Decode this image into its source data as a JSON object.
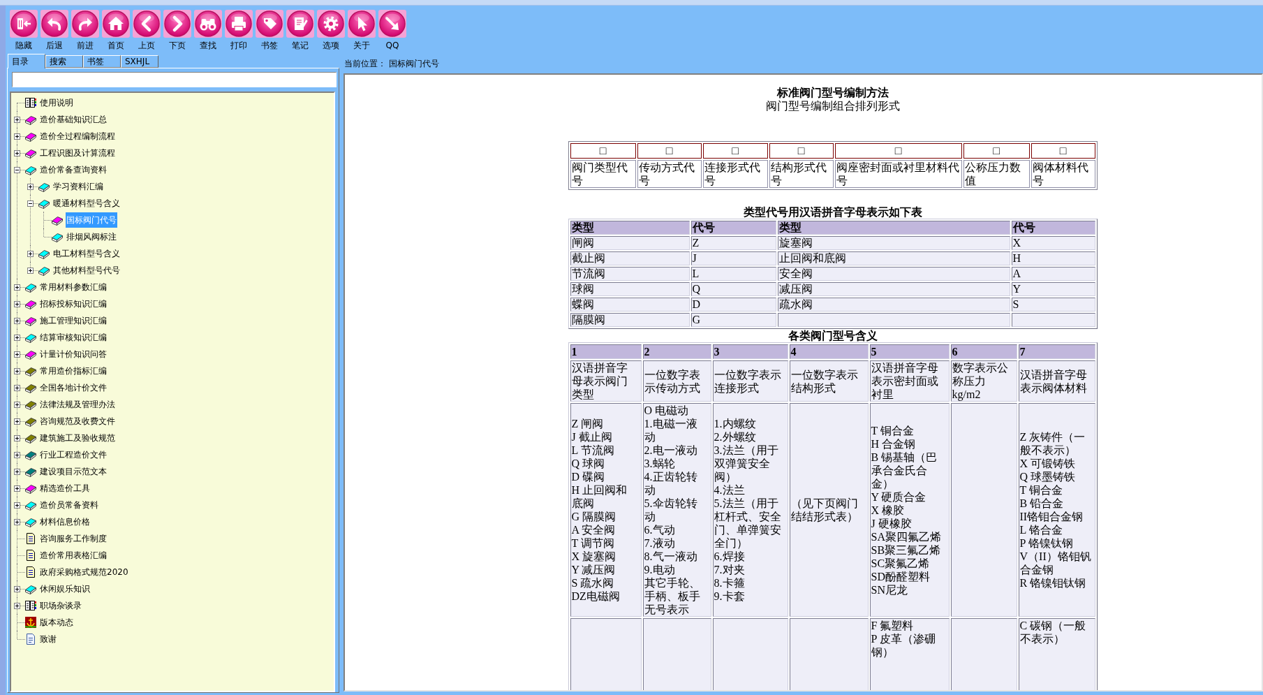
{
  "toolbar": {
    "buttons": [
      {
        "kind": "hide",
        "label": "隐藏"
      },
      {
        "kind": "back",
        "label": "后退"
      },
      {
        "kind": "forward",
        "label": "前进"
      },
      {
        "kind": "home",
        "label": "首页"
      },
      {
        "kind": "prev",
        "label": "上页"
      },
      {
        "kind": "next",
        "label": "下页"
      },
      {
        "kind": "find",
        "label": "查找"
      },
      {
        "kind": "print",
        "label": "打印"
      },
      {
        "kind": "bookmark",
        "label": "书签"
      },
      {
        "kind": "note",
        "label": "笔记"
      },
      {
        "kind": "options",
        "label": "选项"
      },
      {
        "kind": "about",
        "label": "关于"
      },
      {
        "kind": "qq",
        "label": "QQ"
      }
    ]
  },
  "sidebar": {
    "tabs": [
      {
        "label": "目录",
        "selected": true
      },
      {
        "label": "搜索",
        "selected": false
      },
      {
        "label": "书签",
        "selected": false
      },
      {
        "label": "SXHJL",
        "selected": false
      }
    ],
    "tree": {
      "items": [
        {
          "label": "使用说明",
          "kind": "manual",
          "selected": false
        },
        {
          "label": "造价基础知识汇总",
          "kind": "book",
          "color": "#ff00ff",
          "expanded": false,
          "selected": false
        },
        {
          "label": "造价全过程编制流程",
          "kind": "book",
          "color": "#ff00ff",
          "expanded": false,
          "selected": false
        },
        {
          "label": "工程识图及计算流程",
          "kind": "book",
          "color": "#ff00ff",
          "expanded": false,
          "selected": false
        },
        {
          "label": "造价常备查询资料",
          "kind": "book",
          "color": "#00ffff",
          "expanded": true,
          "selected": false,
          "children": [
            {
              "label": "学习资料汇编",
              "kind": "book",
              "color": "#00ffff",
              "expanded": false,
              "selected": false
            },
            {
              "label": "暖通材料型号含义",
              "kind": "book",
              "color": "#00ffff",
              "expanded": true,
              "selected": false,
              "children": [
                {
                  "label": "国标阀门代号",
                  "kind": "book",
                  "color": "#ff00ff",
                  "selected": true
                },
                {
                  "label": "排烟风阀标注",
                  "kind": "book",
                  "color": "#00ffff",
                  "selected": false
                }
              ]
            },
            {
              "label": "电工材料型号含义",
              "kind": "book",
              "color": "#00ffff",
              "expanded": false,
              "selected": false
            },
            {
              "label": "其他材料型号代号",
              "kind": "book",
              "color": "#00ffff",
              "expanded": false,
              "selected": false
            }
          ]
        },
        {
          "label": "常用材料参数汇编",
          "kind": "book",
          "color": "#00ffff",
          "expanded": false,
          "selected": false
        },
        {
          "label": "招标投标知识汇编",
          "kind": "book",
          "color": "#ff00ff",
          "expanded": false,
          "selected": false
        },
        {
          "label": "施工管理知识汇编",
          "kind": "book",
          "color": "#ff00ff",
          "expanded": false,
          "selected": false
        },
        {
          "label": "结算审核知识汇编",
          "kind": "book",
          "color": "#00ffff",
          "expanded": false,
          "selected": false
        },
        {
          "label": "计量计价知识问答",
          "kind": "book",
          "color": "#ff00ff",
          "expanded": false,
          "selected": false
        },
        {
          "label": "常用造价指标汇编",
          "kind": "book",
          "color": "#808000",
          "expanded": false,
          "selected": false
        },
        {
          "label": "全国各地计价文件",
          "kind": "book",
          "color": "#808000",
          "expanded": false,
          "selected": false
        },
        {
          "label": "法律法规及管理办法",
          "kind": "book",
          "color": "#808000",
          "expanded": false,
          "selected": false
        },
        {
          "label": "咨询规范及收费文件",
          "kind": "book",
          "color": "#808000",
          "expanded": false,
          "selected": false
        },
        {
          "label": "建筑施工及验收规范",
          "kind": "book",
          "color": "#808000",
          "expanded": false,
          "selected": false
        },
        {
          "label": "行业工程造价文件",
          "kind": "book",
          "color": "#008080",
          "expanded": false,
          "selected": false
        },
        {
          "label": "建设项目示范文本",
          "kind": "book",
          "color": "#008080",
          "expanded": false,
          "selected": false
        },
        {
          "label": "精选造价工具",
          "kind": "book",
          "color": "#ff00ff",
          "expanded": false,
          "selected": false
        },
        {
          "label": "造价员常备资料",
          "kind": "book",
          "color": "#00ffff",
          "expanded": false,
          "selected": false
        },
        {
          "label": "材料信息价格",
          "kind": "book",
          "color": "#00ffff",
          "expanded": false,
          "selected": false
        },
        {
          "label": "咨询服务工作制度",
          "kind": "note",
          "selected": false
        },
        {
          "label": "造价常用表格汇编",
          "kind": "note",
          "selected": false
        },
        {
          "label": "政府采购格式规范2020",
          "kind": "note",
          "selected": false
        },
        {
          "label": "休闲娱乐知识",
          "kind": "book",
          "color": "#00ffff",
          "expanded": false,
          "selected": false
        },
        {
          "label": "职场杂谈录",
          "kind": "manual",
          "expanded": false,
          "selected": false
        },
        {
          "label": "版本动态",
          "kind": "emblem",
          "selected": false
        },
        {
          "label": "致谢",
          "kind": "page",
          "selected": false
        }
      ]
    }
  },
  "breadcrumb": {
    "label": "当前位置：",
    "current": "国标阀门代号"
  },
  "content": {
    "title": "标准阀门型号编制方法",
    "subtitle": "阀门型号编制组合排列形式",
    "format_table": {
      "slots": [
        {
          "symbol": "□",
          "label": "阀门类型代号"
        },
        {
          "symbol": "□",
          "label": "传动方式代号"
        },
        {
          "symbol": "□",
          "label": "连接形式代号"
        },
        {
          "symbol": "□",
          "label": "结构形式代号"
        },
        {
          "symbol": "□",
          "label": "阀座密封面或衬里材料代号"
        },
        {
          "symbol": "□",
          "label": "公称压力数值"
        },
        {
          "symbol": "□",
          "label": "阀体材料代号"
        }
      ]
    },
    "type_table": {
      "heading": "类型代号用汉语拼音字母表示如下表",
      "columns": [
        "类型",
        "代号",
        "类型",
        "代号"
      ],
      "rows": [
        [
          "闸阀",
          "Z",
          "旋塞阀",
          "X"
        ],
        [
          "截止阀",
          "J",
          "止回阀和底阀",
          "H"
        ],
        [
          "节流阀",
          "L",
          "安全阀",
          "A"
        ],
        [
          "球阀",
          "Q",
          "减压阀",
          "Y"
        ],
        [
          "蝶阀",
          "D",
          "疏水阀",
          "S"
        ],
        [
          "隔膜阀",
          "G"
        ]
      ]
    },
    "meaning_table": {
      "heading": "各类阀门型号含义",
      "columns": [
        "1",
        "2",
        "3",
        "4",
        "5",
        "6",
        "7"
      ],
      "rows": [
        {
          "column_1": "汉语拼音字母表示阀门类型",
          "column_2": "一位数字表示传动方式",
          "column_3": "一位数字表示连接形式",
          "column_4": "一位数字表示结构形式",
          "column_5": "汉语拼音字母表示密封面或衬里",
          "column_6": "数字表示公称压力kg/m2",
          "column_7": "汉语拼音字母表示阀体材料"
        },
        {
          "column_1": [
            "Z 闸阀",
            "J 截止阀",
            "L 节流阀",
            "Q 球阀",
            "D 碟阀",
            "H 止回阀和底阀",
            "G 隔膜阀",
            "A 安全阀",
            "T 调节阀",
            "X 旋塞阀",
            "Y 减压阀",
            "S 疏水阀",
            "DZ电磁阀"
          ],
          "column_2": [
            "O 电磁动",
            "1.电磁一液动",
            "2.电一液动",
            "3.蜗轮",
            "4.正齿轮转动",
            "5.伞齿轮转动",
            "6.气动",
            "7.液动",
            "8.气一液动",
            "9.电动",
            "其它手轮、手柄、板手无号表示"
          ],
          "column_3": [
            "1.内螺纹",
            "2.外螺纹",
            "3.法兰（用于双弹簧安全阀）",
            "4.法兰",
            "5.法兰（用于杠杆式、安全门、单弹簧安全门）",
            "6.焊接",
            "7.对夹",
            "8.卡箍",
            "9.卡套"
          ],
          "column_4": "（见下页阀门结结形式表）",
          "column_5": [
            "T 铜合金",
            "H 合金钢",
            "B 锡基轴（巴承合金氏合金）",
            "Y 硬质合金",
            "X 橡胶",
            "J 硬橡胶",
            "SA聚四氟乙烯",
            "SB聚三氟乙烯",
            "SC聚氟乙烯",
            "SD酚醛塑料",
            "SN尼龙"
          ],
          "column_7": [
            "Z 灰铸件（一般不表示）",
            "X 可锻铸铁",
            "Q 球墨铸铁",
            "T 铜合金",
            "B 铅合金",
            "II铬钼合金钢",
            "L 铬合金",
            "P 铬镍钛钢",
            "V（II）铬钼钒合金钢",
            "R 铬镍钼钛钢"
          ]
        },
        {
          "column_5": [
            "F 氟塑料",
            "P 皮革（渗硼钢）"
          ],
          "column_7": [
            "C 碳钢（一般不表示）"
          ]
        }
      ]
    }
  }
}
